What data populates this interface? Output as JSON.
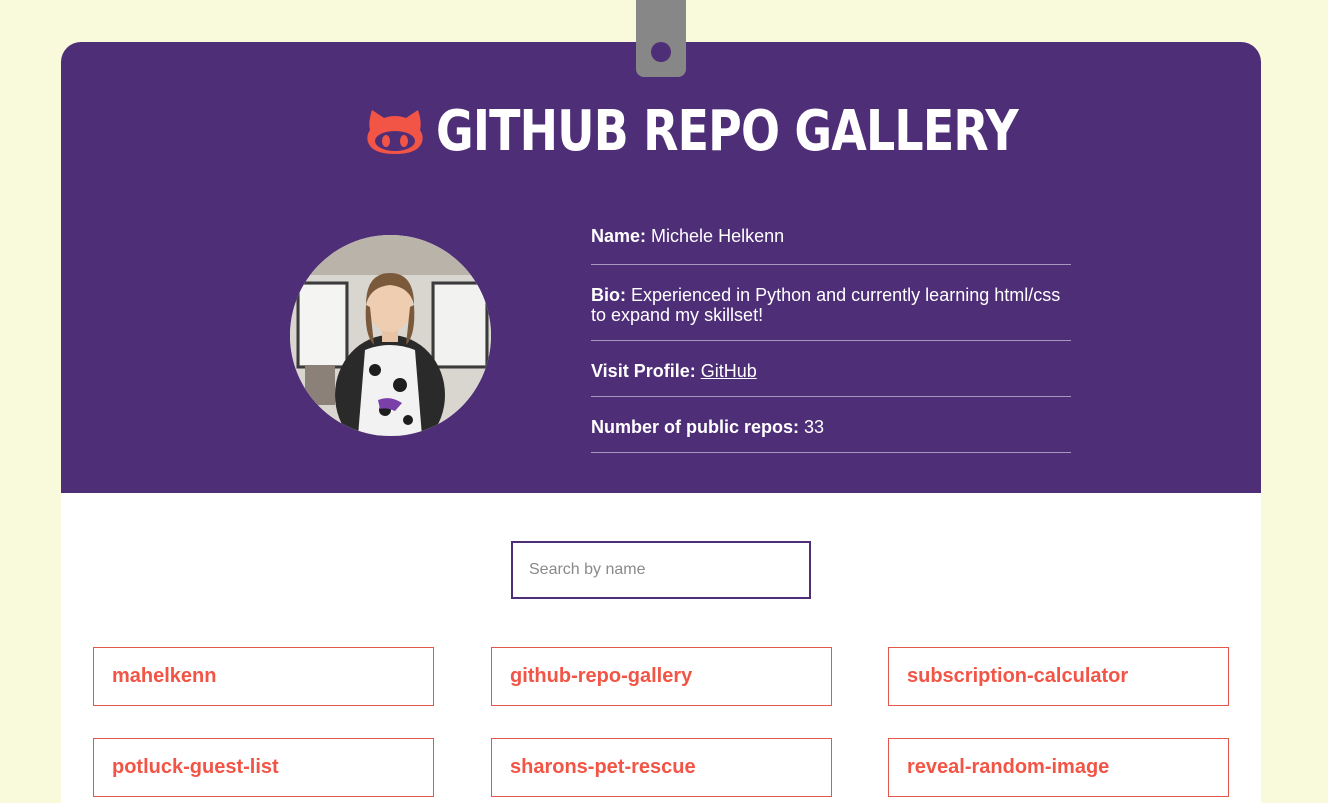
{
  "header": {
    "title": "GITHUB REPO GALLERY",
    "brand_icon": "github-octocat-icon",
    "brand_color": "#f25546",
    "header_color": "#4f2e78"
  },
  "profile": {
    "name_label": "Name:",
    "name_value": "Michele Helkenn",
    "bio_label": "Bio:",
    "bio_value": "Experienced in Python and currently learning html/css to expand my skillset!",
    "visit_label": "Visit Profile:",
    "visit_link": "GitHub",
    "repos_label": "Number of public repos:",
    "repos_value": "33"
  },
  "search": {
    "placeholder": "Search by name",
    "value": ""
  },
  "repos": [
    "mahelkenn",
    "github-repo-gallery",
    "subscription-calculator",
    "potluck-guest-list",
    "sharons-pet-rescue",
    "reveal-random-image"
  ]
}
